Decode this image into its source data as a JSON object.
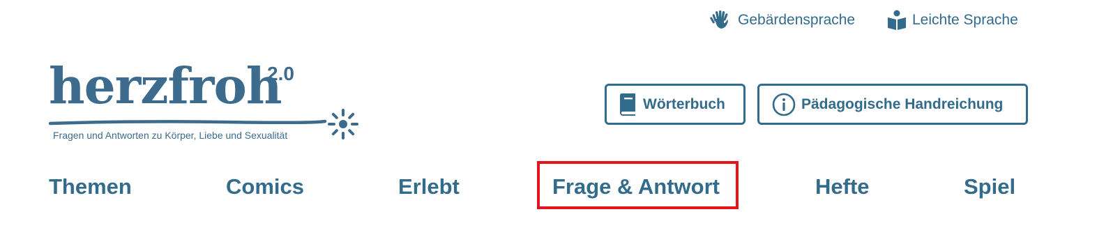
{
  "utility_nav": {
    "sign_language": {
      "label": "Gebärdensprache",
      "icon": "sign-language-hands-icon"
    },
    "easy_language": {
      "label": "Leichte Sprache",
      "icon": "reading-person-icon"
    }
  },
  "logo": {
    "wordmark": "herzfroh",
    "version": "2.0",
    "tagline": "Fragen und Antworten zu Körper, Liebe und Sexualität",
    "icon": "sun-flower-icon"
  },
  "header_buttons": {
    "dictionary": {
      "label": "Wörterbuch",
      "icon": "book-icon"
    },
    "pedagogic": {
      "label": "Pädagogische Handreichung",
      "icon": "info-circle-icon"
    }
  },
  "main_nav": {
    "items": [
      {
        "label": "Themen"
      },
      {
        "label": "Comics"
      },
      {
        "label": "Erlebt"
      },
      {
        "label": "Frage & Antwort",
        "highlighted": true
      },
      {
        "label": "Hefte"
      },
      {
        "label": "Spiel"
      }
    ]
  },
  "colors": {
    "brand": "#336b8c",
    "highlight": "#e3141b",
    "background": "#ffffff"
  }
}
